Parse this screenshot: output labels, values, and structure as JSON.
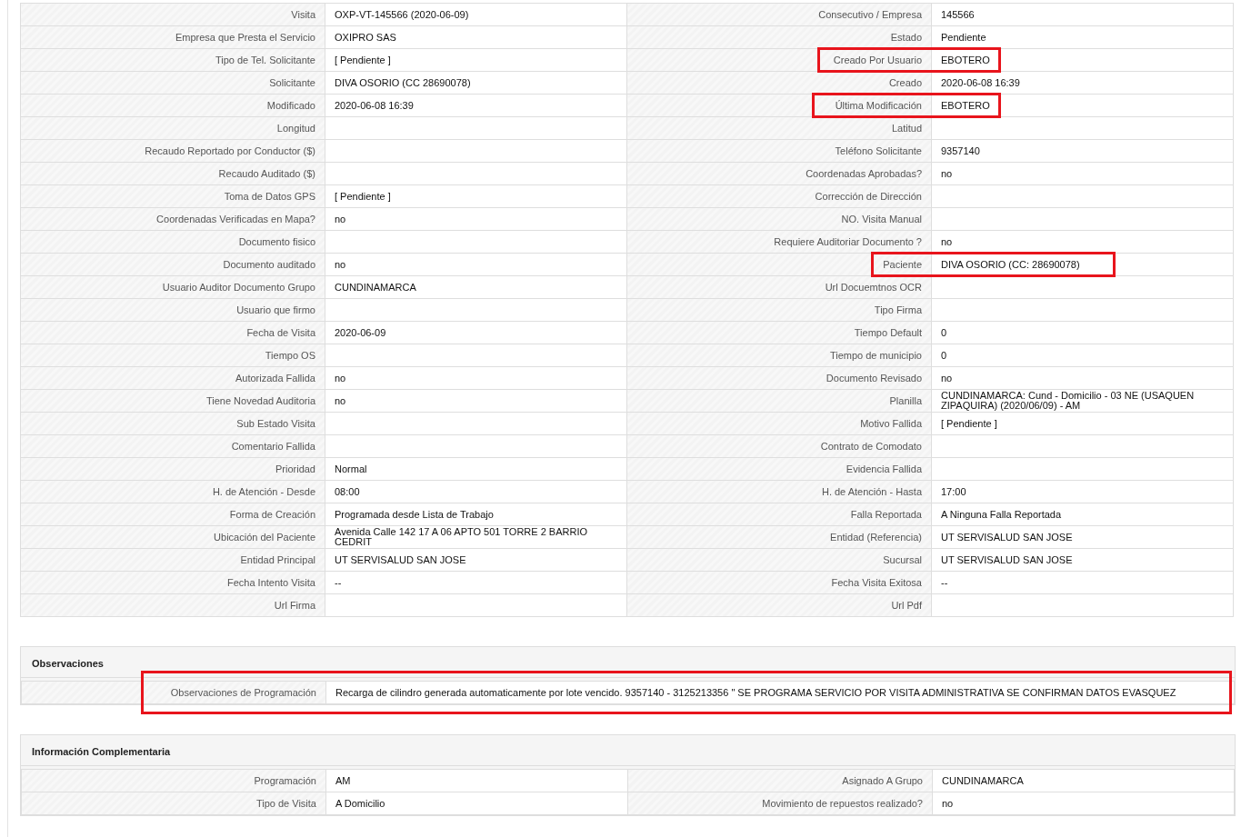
{
  "details": {
    "rows": [
      {
        "left": {
          "label": "Visita",
          "value": "OXP-VT-145566 (2020-06-09)",
          "highlighted": false
        },
        "right": {
          "label": "Consecutivo / Empresa",
          "value": "145566",
          "highlighted": false
        }
      },
      {
        "left": {
          "label": "Empresa que Presta el Servicio",
          "value": "OXIPRO SAS",
          "highlighted": false
        },
        "right": {
          "label": "Estado",
          "value": "Pendiente",
          "highlighted": false
        }
      },
      {
        "left": {
          "label": "Tipo de Tel. Solicitante",
          "value": "[ Pendiente ]",
          "highlighted": false
        },
        "right": {
          "label": "Creado Por Usuario",
          "value": "EBOTERO",
          "highlighted": true
        }
      },
      {
        "left": {
          "label": "Solicitante",
          "value": "DIVA OSORIO (CC 28690078)",
          "highlighted": false
        },
        "right": {
          "label": "Creado",
          "value": "2020-06-08 16:39",
          "highlighted": false
        }
      },
      {
        "left": {
          "label": "Modificado",
          "value": "2020-06-08 16:39",
          "highlighted": false
        },
        "right": {
          "label": "Última Modificación",
          "value": "EBOTERO",
          "highlighted": true
        }
      },
      {
        "left": {
          "label": "Longitud",
          "highlighted": false
        },
        "right": {
          "label": "Latitud",
          "highlighted": false
        }
      },
      {
        "left": {
          "label": "Recaudo Reportado por Conductor ($)",
          "highlighted": false
        },
        "right": {
          "label": "Teléfono Solicitante",
          "value": "9357140",
          "highlighted": false
        }
      },
      {
        "left": {
          "label": "Recaudo Auditado ($)",
          "highlighted": false
        },
        "right": {
          "label": "Coordenadas Aprobadas?",
          "value": "no",
          "highlighted": false
        }
      },
      {
        "left": {
          "label": "Toma de Datos GPS",
          "value": "[ Pendiente ]",
          "highlighted": false
        },
        "right": {
          "label": "Corrección de Dirección",
          "highlighted": false
        }
      },
      {
        "left": {
          "label": "Coordenadas Verificadas en Mapa?",
          "value": "no",
          "highlighted": false
        },
        "right": {
          "label": "NO. Visita Manual",
          "highlighted": false
        }
      },
      {
        "left": {
          "label": "Documento fisico",
          "highlighted": false
        },
        "right": {
          "label": "Requiere Auditoriar Documento ?",
          "value": "no",
          "highlighted": false
        }
      },
      {
        "left": {
          "label": "Documento auditado",
          "value": "no",
          "highlighted": false
        },
        "right": {
          "label": "Paciente",
          "value": "DIVA OSORIO (CC: 28690078)",
          "highlighted": true
        }
      },
      {
        "left": {
          "label": "Usuario Auditor Documento Grupo",
          "value": "CUNDINAMARCA",
          "highlighted": false
        },
        "right": {
          "label": "Url Docuemtnos OCR",
          "highlighted": false
        }
      },
      {
        "left": {
          "label": "Usuario que firmo",
          "highlighted": false
        },
        "right": {
          "label": "Tipo Firma",
          "highlighted": false
        }
      },
      {
        "left": {
          "label": "Fecha de Visita",
          "value": "2020-06-09",
          "highlighted": false
        },
        "right": {
          "label": "Tiempo Default",
          "value": "0",
          "highlighted": false
        }
      },
      {
        "left": {
          "label": "Tiempo OS",
          "highlighted": false
        },
        "right": {
          "label": "Tiempo de municipio",
          "value": "0",
          "highlighted": false
        }
      },
      {
        "left": {
          "label": "Autorizada Fallida",
          "value": "no",
          "highlighted": false
        },
        "right": {
          "label": "Documento Revisado",
          "value": "no",
          "highlighted": false
        }
      },
      {
        "left": {
          "label": "Tiene Novedad Auditoria",
          "value": "no",
          "highlighted": false
        },
        "right": {
          "label": "Planilla",
          "value": "CUNDINAMARCA: Cund - Domicilio - 03 NE (USAQUEN ZIPAQUIRA) (2020/06/09) - AM",
          "highlighted": false
        }
      },
      {
        "left": {
          "label": "Sub Estado Visita",
          "highlighted": false
        },
        "right": {
          "label": "Motivo Fallida",
          "value": "[ Pendiente ]",
          "highlighted": false
        }
      },
      {
        "left": {
          "label": "Comentario Fallida",
          "highlighted": false
        },
        "right": {
          "label": "Contrato de Comodato",
          "highlighted": false
        }
      },
      {
        "left": {
          "label": "Prioridad",
          "value": "Normal",
          "highlighted": false
        },
        "right": {
          "label": "Evidencia Fallida",
          "highlighted": false
        }
      },
      {
        "left": {
          "label": "H. de Atención - Desde",
          "value": "08:00",
          "highlighted": false
        },
        "right": {
          "label": "H. de Atención - Hasta",
          "value": "17:00",
          "highlighted": false
        }
      },
      {
        "left": {
          "label": "Forma de Creación",
          "value": "Programada desde Lista de Trabajo",
          "highlighted": false
        },
        "right": {
          "label": "Falla Reportada",
          "value": "A Ninguna Falla Reportada",
          "highlighted": false
        }
      },
      {
        "left": {
          "label": "Ubicación del Paciente",
          "value": "Avenida Calle 142 17 A 06 APTO 501 TORRE 2 BARRIO CEDRIT",
          "highlighted": false
        },
        "right": {
          "label": "Entidad (Referencia)",
          "value": "UT SERVISALUD SAN JOSE",
          "highlighted": false
        }
      },
      {
        "left": {
          "label": "Entidad Principal",
          "value": "UT SERVISALUD SAN JOSE",
          "highlighted": false
        },
        "right": {
          "label": "Sucursal",
          "value": "UT SERVISALUD SAN JOSE",
          "highlighted": false
        }
      },
      {
        "left": {
          "label": "Fecha Intento Visita",
          "value": "--",
          "highlighted": false
        },
        "right": {
          "label": "Fecha Visita Exitosa",
          "value": "--",
          "highlighted": false
        }
      },
      {
        "left": {
          "label": "Url Firma",
          "highlighted": false
        },
        "right": {
          "label": "Url Pdf",
          "highlighted": false
        }
      }
    ]
  },
  "observaciones": {
    "title": "Observaciones",
    "rows": [
      {
        "label": "Observaciones de Programación",
        "value": "Recarga de cilindro generada automaticamente por lote vencido. 9357140 - 3125213356 \" SE PROGRAMA SERVICIO POR VISITA ADMINISTRATIVA SE CONFIRMAN DATOS EVASQUEZ",
        "highlighted": true
      }
    ]
  },
  "informacion_complementaria": {
    "title": "Información Complementaria",
    "rows": [
      {
        "left": {
          "label": "Programación",
          "value": "AM",
          "highlighted": false
        },
        "right": {
          "label": "Asignado A Grupo",
          "value": "CUNDINAMARCA",
          "highlighted": false
        }
      },
      {
        "left": {
          "label": "Tipo de Visita",
          "value": "A Domicilio",
          "highlighted": false
        },
        "right": {
          "label": "Movimiento de repuestos realizado?",
          "value": "no",
          "highlighted": false
        }
      }
    ]
  }
}
